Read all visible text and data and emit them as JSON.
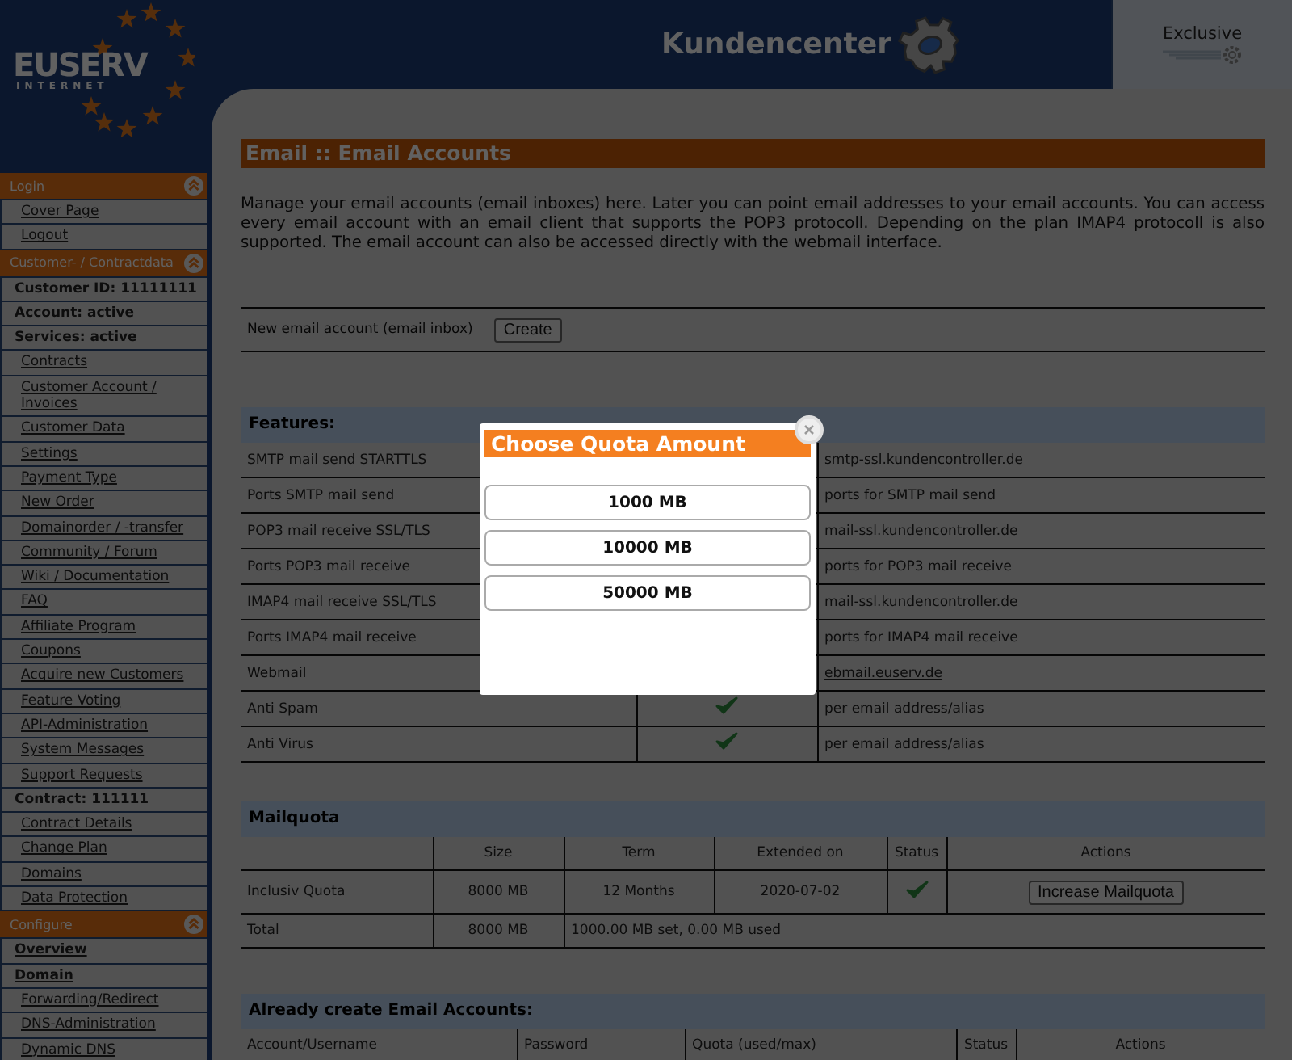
{
  "header": {
    "logo_main": "EUSERV",
    "logo_sub": "INTERNET",
    "title": "Kundencenter",
    "plan": "Exclusive"
  },
  "sidebar": {
    "sections": [
      {
        "title": "Login",
        "expanded": true,
        "items": [
          {
            "label": "Cover Page",
            "kind": "link"
          },
          {
            "label": "Logout",
            "kind": "link"
          }
        ]
      },
      {
        "title": "Customer- / Contractdata",
        "expanded": true,
        "items": [
          {
            "label": "Customer ID: 11111111",
            "kind": "info"
          },
          {
            "label": "Account: active",
            "kind": "info"
          },
          {
            "label": "Services: active",
            "kind": "info"
          },
          {
            "label": "Contracts",
            "kind": "link"
          },
          {
            "label": "Customer Account / Invoices",
            "kind": "link"
          },
          {
            "label": "Customer Data",
            "kind": "link"
          },
          {
            "label": "Settings",
            "kind": "link"
          },
          {
            "label": "Payment Type",
            "kind": "link"
          },
          {
            "label": "New Order",
            "kind": "link"
          },
          {
            "label": "Domainorder / -transfer",
            "kind": "link"
          },
          {
            "label": "Community / Forum",
            "kind": "link"
          },
          {
            "label": "Wiki / Documentation",
            "kind": "link"
          },
          {
            "label": "FAQ",
            "kind": "link"
          },
          {
            "label": "Affiliate Program",
            "kind": "link"
          },
          {
            "label": "Coupons",
            "kind": "link"
          },
          {
            "label": "Acquire new Customers",
            "kind": "link"
          },
          {
            "label": "Feature Voting",
            "kind": "link"
          },
          {
            "label": "API-Administration",
            "kind": "link"
          },
          {
            "label": "System Messages",
            "kind": "link"
          },
          {
            "label": "Support Requests",
            "kind": "link"
          },
          {
            "label": "Contract: 111111",
            "kind": "info"
          },
          {
            "label": "Contract Details",
            "kind": "link"
          },
          {
            "label": "Change Plan",
            "kind": "link"
          },
          {
            "label": "Domains",
            "kind": "link"
          },
          {
            "label": "Data Protection",
            "kind": "link"
          }
        ]
      },
      {
        "title": "Configure",
        "expanded": true,
        "items": [
          {
            "label": "Overview",
            "kind": "boldlink"
          },
          {
            "label": "Domain",
            "kind": "boldlink"
          },
          {
            "label": "Forwarding/Redirect",
            "kind": "link"
          },
          {
            "label": "DNS-Administration",
            "kind": "link"
          },
          {
            "label": "Dynamic DNS",
            "kind": "link"
          }
        ]
      }
    ]
  },
  "page": {
    "title": "Email :: Email Accounts",
    "intro": "Manage your email accounts (email inboxes) here. Later you can point email addresses to your email accounts. You can access every email account with an email client that supports the POP3 protocoll. Depending on the plan IMAP4 protocoll is also supported. The email account can also be accessed directly with the webmail interface.",
    "new_account_label": "New email account (email inbox)",
    "create_button": "Create"
  },
  "features": {
    "title": "Features:",
    "rows": [
      {
        "name": "SMTP mail send STARTTLS",
        "value": "smtp-ssl.kundencontroller.de",
        "kind": "text"
      },
      {
        "name": "Ports SMTP mail send",
        "value": "ports for SMTP mail send",
        "kind": "text"
      },
      {
        "name": "POP3 mail receive SSL/TLS",
        "value": "mail-ssl.kundencontroller.de",
        "kind": "text"
      },
      {
        "name": "Ports POP3 mail receive",
        "value": "ports for POP3 mail receive",
        "kind": "text"
      },
      {
        "name": "IMAP4 mail receive SSL/TLS",
        "value": "mail-ssl.kundencontroller.de",
        "kind": "text"
      },
      {
        "name": "Ports IMAP4 mail receive",
        "value": "ports for IMAP4 mail receive",
        "kind": "text"
      },
      {
        "name": "Webmail",
        "value": "ebmail.euserv.de",
        "kind": "link"
      },
      {
        "name": "Anti Spam",
        "check": true,
        "value": "per email address/alias",
        "kind": "text"
      },
      {
        "name": "Anti Virus",
        "check": true,
        "value": "per email address/alias",
        "kind": "text"
      }
    ]
  },
  "mailquota": {
    "title": "Mailquota",
    "columns": [
      "Size",
      "Term",
      "Extended on",
      "Status",
      "Actions"
    ],
    "row": {
      "name": "Inclusiv Quota",
      "size": "8000 MB",
      "term": "12 Months",
      "extended_on": "2020-07-02",
      "status_ok": true,
      "action": "Increase Mailquota"
    },
    "total": {
      "name": "Total",
      "size": "8000 MB",
      "summary": "1000.00 MB set, 0.00 MB used"
    }
  },
  "accounts": {
    "title": "Already create Email Accounts:",
    "columns": [
      "Account/Username",
      "Password",
      "Quota (used/max)",
      "Status",
      "Actions"
    ]
  },
  "modal": {
    "title": "Choose Quota Amount",
    "options": [
      "1000 MB",
      "10000 MB",
      "50000 MB"
    ]
  }
}
